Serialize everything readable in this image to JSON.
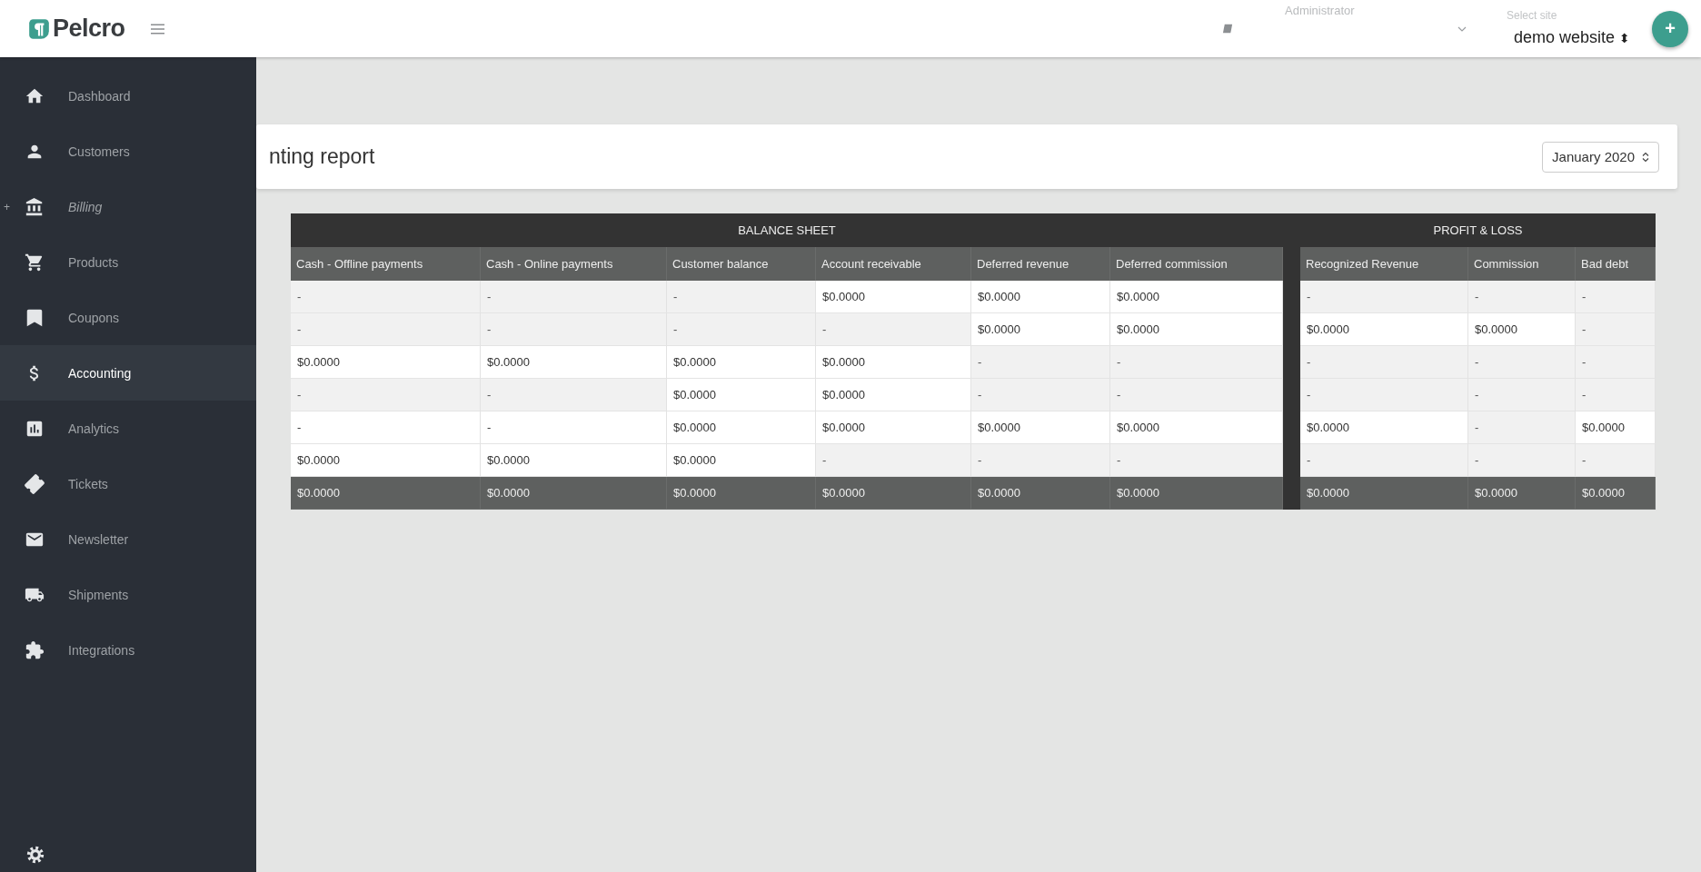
{
  "header": {
    "brand": "Pelcro",
    "user_label": "Administrator",
    "site_label": "Select site",
    "site_value": "demo website",
    "site_arrows": "⬍",
    "add_button": "+"
  },
  "sidebar": {
    "items": [
      {
        "label": "Dashboard",
        "selected": false,
        "kind": "link"
      },
      {
        "label": "Customers",
        "selected": false,
        "kind": "link"
      },
      {
        "label": "Billing",
        "selected": false,
        "kind": "group",
        "marker": "+"
      },
      {
        "label": "Products",
        "selected": false,
        "kind": "link"
      },
      {
        "label": "Coupons",
        "selected": false,
        "kind": "link"
      },
      {
        "label": "Accounting",
        "selected": true,
        "kind": "link"
      },
      {
        "label": "Analytics",
        "selected": false,
        "kind": "link"
      },
      {
        "label": "Tickets",
        "selected": false,
        "kind": "link"
      },
      {
        "label": "Newsletter",
        "selected": false,
        "kind": "link"
      },
      {
        "label": "Shipments",
        "selected": false,
        "kind": "link"
      },
      {
        "label": "Integrations",
        "selected": false,
        "kind": "link"
      }
    ]
  },
  "report": {
    "title": "nting report",
    "period": "January 2020"
  },
  "table": {
    "sections": [
      {
        "title": "BALANCE SHEET",
        "columns": [
          "Cash - Offline payments",
          "Cash - Online payments",
          "Customer balance",
          "Account receivable",
          "Deferred revenue",
          "Deferred commission"
        ]
      },
      {
        "title": "PROFIT & LOSS",
        "columns": [
          "Recognized Revenue",
          "Commission",
          "Bad debt"
        ]
      }
    ],
    "rows": [
      {
        "cells": [
          {
            "text": "-",
            "highlighted": false
          },
          {
            "text": "-",
            "highlighted": false
          },
          {
            "text": "-",
            "highlighted": false
          },
          {
            "text": "$0.0000",
            "highlighted": true
          },
          {
            "text": "$0.0000",
            "highlighted": true
          },
          {
            "text": "$0.0000",
            "highlighted": true
          },
          {
            "text": "-",
            "highlighted": false
          },
          {
            "text": "-",
            "highlighted": false
          },
          {
            "text": "-",
            "highlighted": false
          }
        ]
      },
      {
        "cells": [
          {
            "text": "-",
            "highlighted": false
          },
          {
            "text": "-",
            "highlighted": false
          },
          {
            "text": "-",
            "highlighted": false
          },
          {
            "text": "-",
            "highlighted": false
          },
          {
            "text": "$0.0000",
            "highlighted": true
          },
          {
            "text": "$0.0000",
            "highlighted": true
          },
          {
            "text": "$0.0000",
            "highlighted": true
          },
          {
            "text": "$0.0000",
            "highlighted": true
          },
          {
            "text": "-",
            "highlighted": false
          }
        ]
      },
      {
        "cells": [
          {
            "text": "$0.0000",
            "highlighted": true
          },
          {
            "text": "$0.0000",
            "highlighted": true
          },
          {
            "text": "$0.0000",
            "highlighted": true
          },
          {
            "text": "$0.0000",
            "highlighted": true
          },
          {
            "text": "-",
            "highlighted": false
          },
          {
            "text": "-",
            "highlighted": false
          },
          {
            "text": "-",
            "highlighted": false
          },
          {
            "text": "-",
            "highlighted": false
          },
          {
            "text": "-",
            "highlighted": false
          }
        ]
      },
      {
        "cells": [
          {
            "text": "-",
            "highlighted": false
          },
          {
            "text": "-",
            "highlighted": false
          },
          {
            "text": "$0.0000",
            "highlighted": true
          },
          {
            "text": "$0.0000",
            "highlighted": true
          },
          {
            "text": "-",
            "highlighted": false
          },
          {
            "text": "-",
            "highlighted": false
          },
          {
            "text": "-",
            "highlighted": false
          },
          {
            "text": "-",
            "highlighted": false
          },
          {
            "text": "-",
            "highlighted": false
          }
        ]
      },
      {
        "cells": [
          {
            "text": "-",
            "highlighted": true
          },
          {
            "text": "-",
            "highlighted": true
          },
          {
            "text": "$0.0000",
            "highlighted": true
          },
          {
            "text": "$0.0000",
            "highlighted": true
          },
          {
            "text": "$0.0000",
            "highlighted": true
          },
          {
            "text": "$0.0000",
            "highlighted": true
          },
          {
            "text": "$0.0000",
            "highlighted": true
          },
          {
            "text": "-",
            "highlighted": false
          },
          {
            "text": "$0.0000",
            "highlighted": true
          }
        ]
      },
      {
        "cells": [
          {
            "text": "$0.0000",
            "highlighted": true
          },
          {
            "text": "$0.0000",
            "highlighted": true
          },
          {
            "text": "$0.0000",
            "highlighted": true
          },
          {
            "text": "-",
            "highlighted": false
          },
          {
            "text": "-",
            "highlighted": false
          },
          {
            "text": "-",
            "highlighted": false
          },
          {
            "text": "-",
            "highlighted": false
          },
          {
            "text": "-",
            "highlighted": false
          },
          {
            "text": "-",
            "highlighted": false
          }
        ]
      }
    ],
    "totals": [
      "$0.0000",
      "$0.0000",
      "$0.0000",
      "$0.0000",
      "$0.0000",
      "$0.0000",
      "$0.0000",
      "$0.0000",
      "$0.0000"
    ]
  }
}
